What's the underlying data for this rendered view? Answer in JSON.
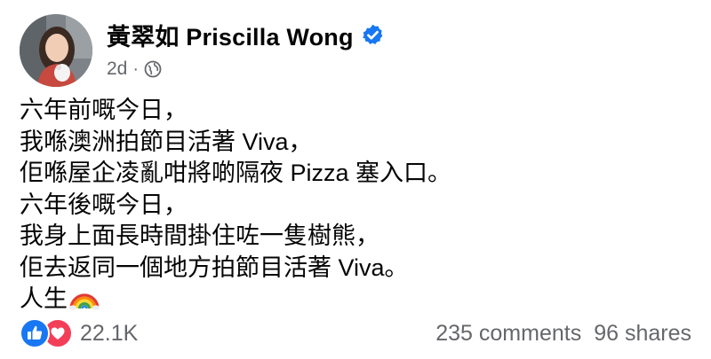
{
  "post": {
    "author_name": "黃翠如 Priscilla Wong",
    "verified": true,
    "timestamp": "2d",
    "separator": "·",
    "privacy_icon": "globe-icon",
    "lines": [
      "六年前嘅今日，",
      "我喺澳洲拍節目活著 Viva，",
      "佢喺屋企凌亂咁將啲隔夜 Pizza 塞入口。",
      "六年後嘅今日，",
      "我身上面長時間掛住咗一隻樹熊，",
      "佢去返同一個地方拍節目活著 Viva。",
      "人生"
    ],
    "emoji": "rainbow-emoji"
  },
  "footer": {
    "reaction_icons": [
      "like-icon",
      "love-icon"
    ],
    "reaction_count": "22.1K",
    "comments": "235 comments",
    "shares": "96 shares"
  },
  "colors": {
    "verified_blue": "#1877f2",
    "like_blue": "#1877f2",
    "love_red": "#f33e58",
    "secondary_text": "#65676b"
  }
}
